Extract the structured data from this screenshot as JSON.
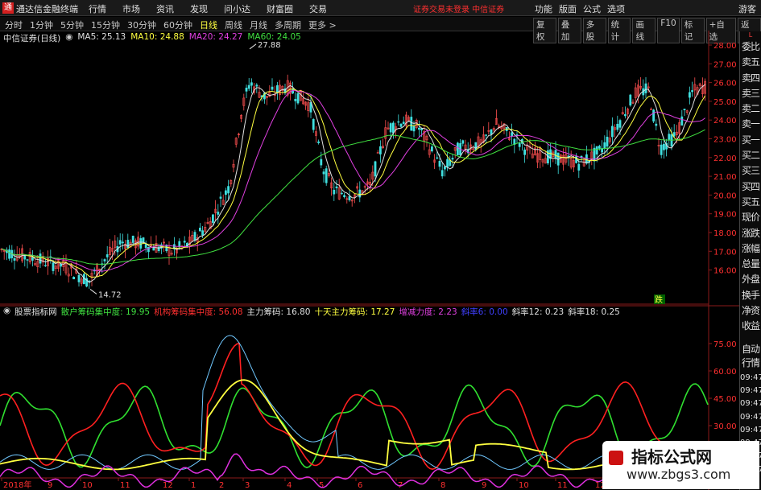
{
  "titlebar": {
    "app_name": "通达信金融终端",
    "menu": [
      "行情",
      "市场",
      "资讯",
      "发现",
      "问小达",
      "财富圈",
      "交易"
    ],
    "status": "证券交易未登录  中信证券",
    "right_menu": [
      "功能",
      "版面",
      "公式",
      "选项"
    ],
    "guest": "游客"
  },
  "periodbar": {
    "periods": [
      "分时",
      "1分钟",
      "5分钟",
      "15分钟",
      "30分钟",
      "60分钟",
      "日线",
      "周线",
      "月线",
      "多周期",
      "更多 >"
    ],
    "active_period": "日线",
    "right_buttons": [
      "复权",
      "叠加",
      "多股",
      "统计",
      "画线",
      "F10",
      "标记",
      "+自选",
      "返回"
    ]
  },
  "infobar": {
    "stock": "中信证券(日线)",
    "ma5": "MA5: 25.13",
    "ma10": "MA10: 24.88",
    "ma20": "MA20: 24.27",
    "ma60": "MA60: 24.05"
  },
  "indbar": {
    "name": "股票指标网",
    "items": [
      {
        "label": "散户筹码集中度: 19.95",
        "color": "#40e040"
      },
      {
        "label": "机构筹码集中度: 56.08",
        "color": "#ff3030"
      },
      {
        "label": "主力筹码: 16.80",
        "color": "#e0e0e0"
      },
      {
        "label": "十天主力筹码: 17.27",
        "color": "#ffff40"
      },
      {
        "label": "增减力度: 2.23",
        "color": "#e040e0"
      },
      {
        "label": "斜率6: 0.00",
        "color": "#4040ff"
      },
      {
        "label": "斜率12: 0.23",
        "color": "#e0e0e0"
      },
      {
        "label": "斜率18: 0.25",
        "color": "#e0e0e0"
      }
    ]
  },
  "price_axis": [
    "28.00",
    "27.00",
    "26.00",
    "25.00",
    "24.00",
    "23.00",
    "22.00",
    "21.00",
    "20.00",
    "19.00",
    "18.00",
    "17.00",
    "16.00"
  ],
  "ind_axis": [
    "75.00",
    "60.00",
    "45.00",
    "30.00",
    "15.00"
  ],
  "date_axis": [
    "2018年",
    "9",
    "10",
    "11",
    "12",
    "1",
    "2",
    "3",
    "4",
    "5",
    "6",
    "7",
    "8",
    "9",
    "10",
    "11",
    "12"
  ],
  "annotations": {
    "high": "27.88",
    "low": "14.72",
    "signal": "跌"
  },
  "side_panel": {
    "top": "L",
    "items": [
      "委比",
      "卖五",
      "卖四",
      "卖三",
      "卖二",
      "卖一",
      "买一",
      "买二",
      "买三",
      "买四",
      "买五",
      "现价",
      "涨跌",
      "涨幅",
      "总量",
      "外盘",
      "换手",
      "净资",
      "收益"
    ],
    "items2": [
      "自动",
      "行情"
    ],
    "times": [
      "09:47",
      "09:47",
      "09:47",
      "09:47",
      "09:47",
      "09:47",
      "09:47",
      "09:47"
    ]
  },
  "watermark": {
    "title": "指标公式网",
    "url": "www.zbgs3.com"
  }
}
